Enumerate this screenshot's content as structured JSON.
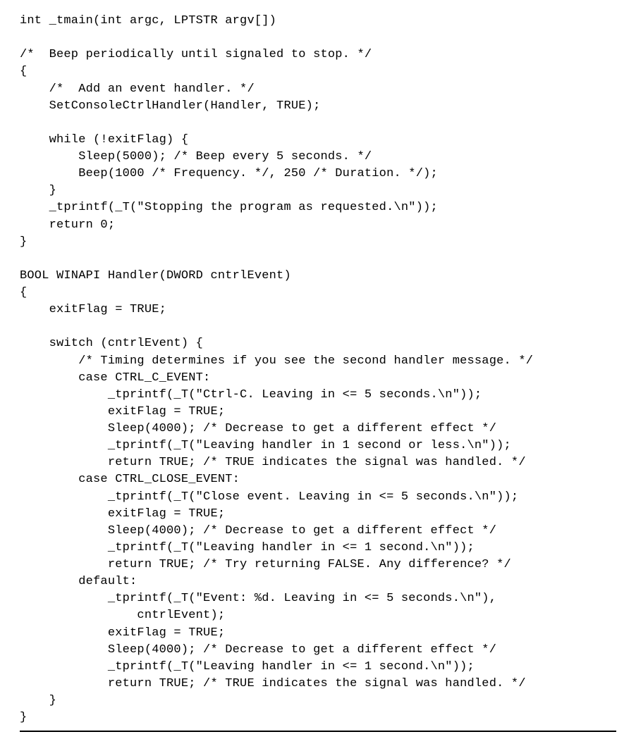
{
  "code_lines": [
    "int _tmain(int argc, LPTSTR argv[])",
    "",
    "/*  Beep periodically until signaled to stop. */",
    "{",
    "    /*  Add an event handler. */",
    "    SetConsoleCtrlHandler(Handler, TRUE);",
    "",
    "    while (!exitFlag) {",
    "        Sleep(5000); /* Beep every 5 seconds. */",
    "        Beep(1000 /* Frequency. */, 250 /* Duration. */);",
    "    }",
    "    _tprintf(_T(\"Stopping the program as requested.\\n\"));",
    "    return 0;",
    "}",
    "",
    "BOOL WINAPI Handler(DWORD cntrlEvent)",
    "{",
    "    exitFlag = TRUE;",
    "",
    "    switch (cntrlEvent) {",
    "        /* Timing determines if you see the second handler message. */",
    "        case CTRL_C_EVENT:",
    "            _tprintf(_T(\"Ctrl-C. Leaving in <= 5 seconds.\\n\"));",
    "            exitFlag = TRUE;",
    "            Sleep(4000); /* Decrease to get a different effect */",
    "            _tprintf(_T(\"Leaving handler in 1 second or less.\\n\"));",
    "            return TRUE; /* TRUE indicates the signal was handled. */",
    "        case CTRL_CLOSE_EVENT:",
    "            _tprintf(_T(\"Close event. Leaving in <= 5 seconds.\\n\"));",
    "            exitFlag = TRUE;",
    "            Sleep(4000); /* Decrease to get a different effect */",
    "            _tprintf(_T(\"Leaving handler in <= 1 second.\\n\"));",
    "            return TRUE; /* Try returning FALSE. Any difference? */",
    "        default:",
    "            _tprintf(_T(\"Event: %d. Leaving in <= 5 seconds.\\n\"),",
    "                cntrlEvent);",
    "            exitFlag = TRUE;",
    "            Sleep(4000); /* Decrease to get a different effect */",
    "            _tprintf(_T(\"Leaving handler in <= 1 second.\\n\"));",
    "            return TRUE; /* TRUE indicates the signal was handled. */",
    "    }",
    "}"
  ]
}
